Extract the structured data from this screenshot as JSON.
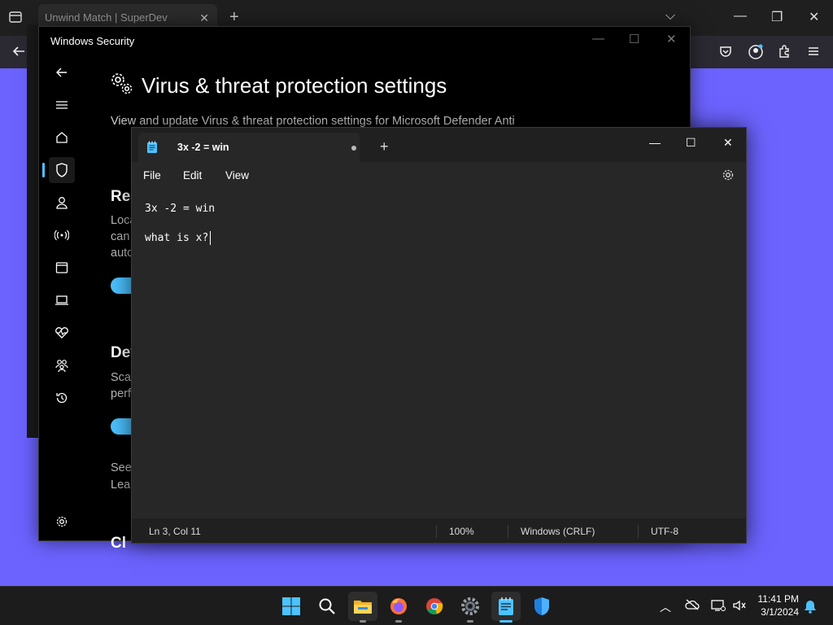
{
  "browser": {
    "tab_title": "Unwind Match | SuperDev",
    "close_glyph": "✕",
    "new_tab_glyph": "+",
    "controls": {
      "dropdown": "⌵",
      "minimize": "—",
      "maximize": "❐",
      "close": "✕"
    },
    "toolbar_icons": [
      "back-arrow-icon",
      "pocket-icon",
      "account-icon",
      "extensions-icon",
      "menu-icon"
    ]
  },
  "security": {
    "window_title": "Windows Security",
    "heading": "Virus & threat protection settings",
    "description": "View and update Virus & threat protection settings for Microsoft Defender Anti",
    "fragments": {
      "real_time_heading": "Rea",
      "real_time_line1": "Loca",
      "real_time_line2": "can",
      "real_time_line3": "auto",
      "dev_heading": "Dev",
      "dev_line1": "Scar",
      "dev_line2": "perf",
      "see_link": "See",
      "learn_link": "Lear",
      "bottom_heading": "Cl"
    },
    "nav_icons": [
      "back-icon",
      "menu-icon",
      "home-icon",
      "shield-icon",
      "account-icon",
      "wifi-icon",
      "app-browser-icon",
      "device-icon",
      "health-icon",
      "family-icon",
      "history-icon",
      "settings-icon"
    ],
    "controls": {
      "minimize": "—",
      "maximize": "☐",
      "close": "✕"
    }
  },
  "notepad": {
    "tab_title": "3x -2 = win",
    "new_tab_glyph": "+",
    "controls": {
      "minimize": "—",
      "maximize": "☐",
      "close": "✕"
    },
    "menu": {
      "file": "File",
      "edit": "Edit",
      "view": "View"
    },
    "lines": [
      "3x -2 = win",
      "what is x?"
    ],
    "status": {
      "position": "Ln 3, Col 11",
      "zoom": "100%",
      "line_ending": "Windows (CRLF)",
      "encoding": "UTF-8"
    }
  },
  "taskbar": {
    "apps": [
      "windows-start-icon",
      "search-icon",
      "file-explorer-icon",
      "firefox-icon",
      "chrome-icon",
      "settings-icon",
      "notepad-icon",
      "windows-security-icon"
    ],
    "tray": {
      "chevron": "︿"
    },
    "clock": {
      "time": "11:41 PM",
      "date": "3/1/2024"
    }
  },
  "colors": {
    "desktop": "#6c63ff",
    "accent": "#4cc2ff",
    "notepad_bg": "#272727",
    "security_bg": "#000000"
  }
}
